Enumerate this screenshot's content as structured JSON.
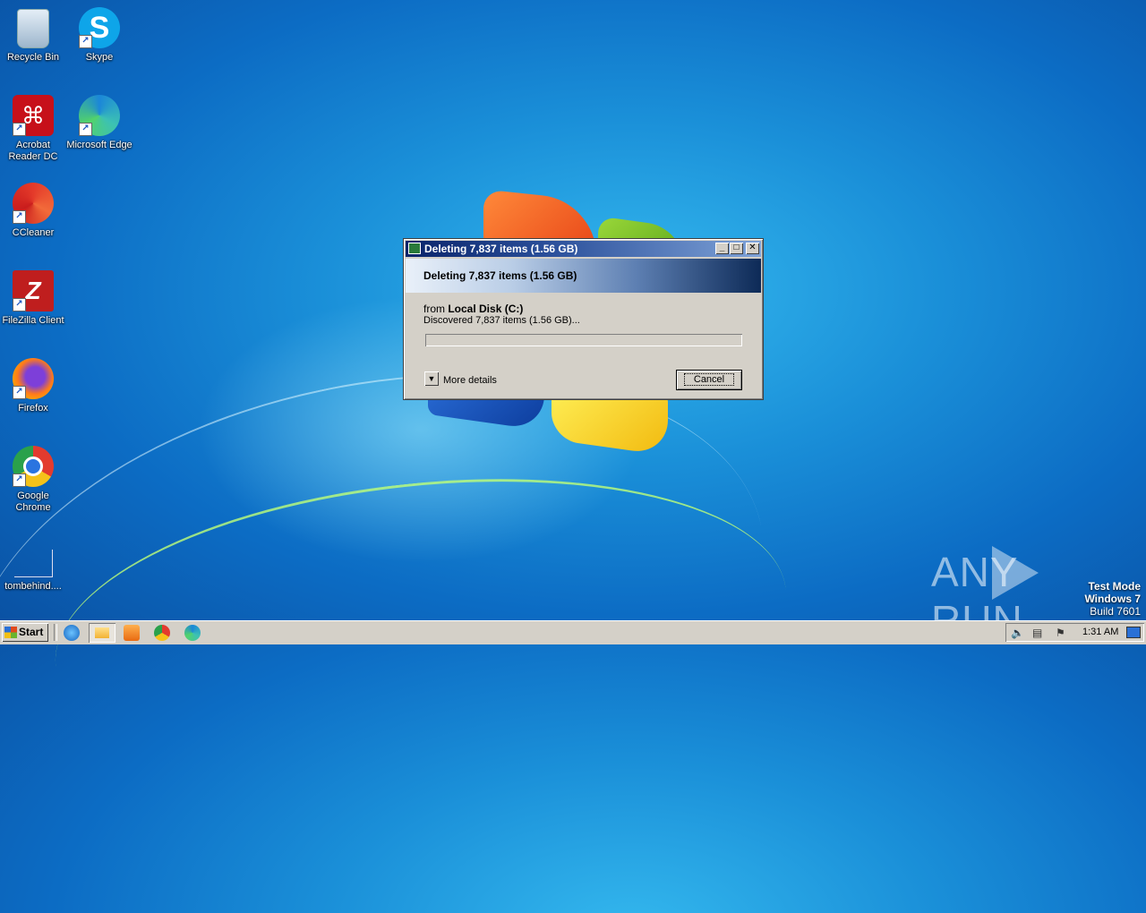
{
  "desktop": {
    "icons": [
      {
        "label": "Recycle Bin"
      },
      {
        "label": "Skype"
      },
      {
        "label": "Acrobat Reader DC"
      },
      {
        "label": "Microsoft Edge"
      },
      {
        "label": "CCleaner"
      },
      {
        "label": "FileZilla Client"
      },
      {
        "label": "Firefox"
      },
      {
        "label": "Google Chrome"
      },
      {
        "label": "tombehind...."
      }
    ]
  },
  "dialog": {
    "title": "Deleting 7,837 items (1.56 GB)",
    "heading": "Deleting 7,837 items (1.56 GB)",
    "from_prefix": "from",
    "from_location": "Local Disk (C:)",
    "status": "Discovered 7,837 items (1.56 GB)...",
    "progress_percent": 0,
    "more_details": "More details",
    "cancel": "Cancel",
    "buttons": {
      "minimize": "_",
      "maximize": "□",
      "close": "✕"
    }
  },
  "watermark": {
    "left": "ANY",
    "right": "RUN"
  },
  "os_info": {
    "line1": "Test Mode",
    "line2": "Windows 7",
    "line3": "Build 7601"
  },
  "taskbar": {
    "start": "Start",
    "quick_launch": [
      "internet-explorer-icon",
      "file-explorer-icon",
      "media-player-icon",
      "chrome-icon",
      "edge-icon"
    ],
    "tray": {
      "clock": "1:31 AM",
      "icons": [
        "speaker-icon",
        "network-icon",
        "flag-icon",
        "monitor-icon"
      ]
    }
  },
  "colors": {
    "title_active": "#0a246a",
    "face": "#d4d0c8"
  }
}
